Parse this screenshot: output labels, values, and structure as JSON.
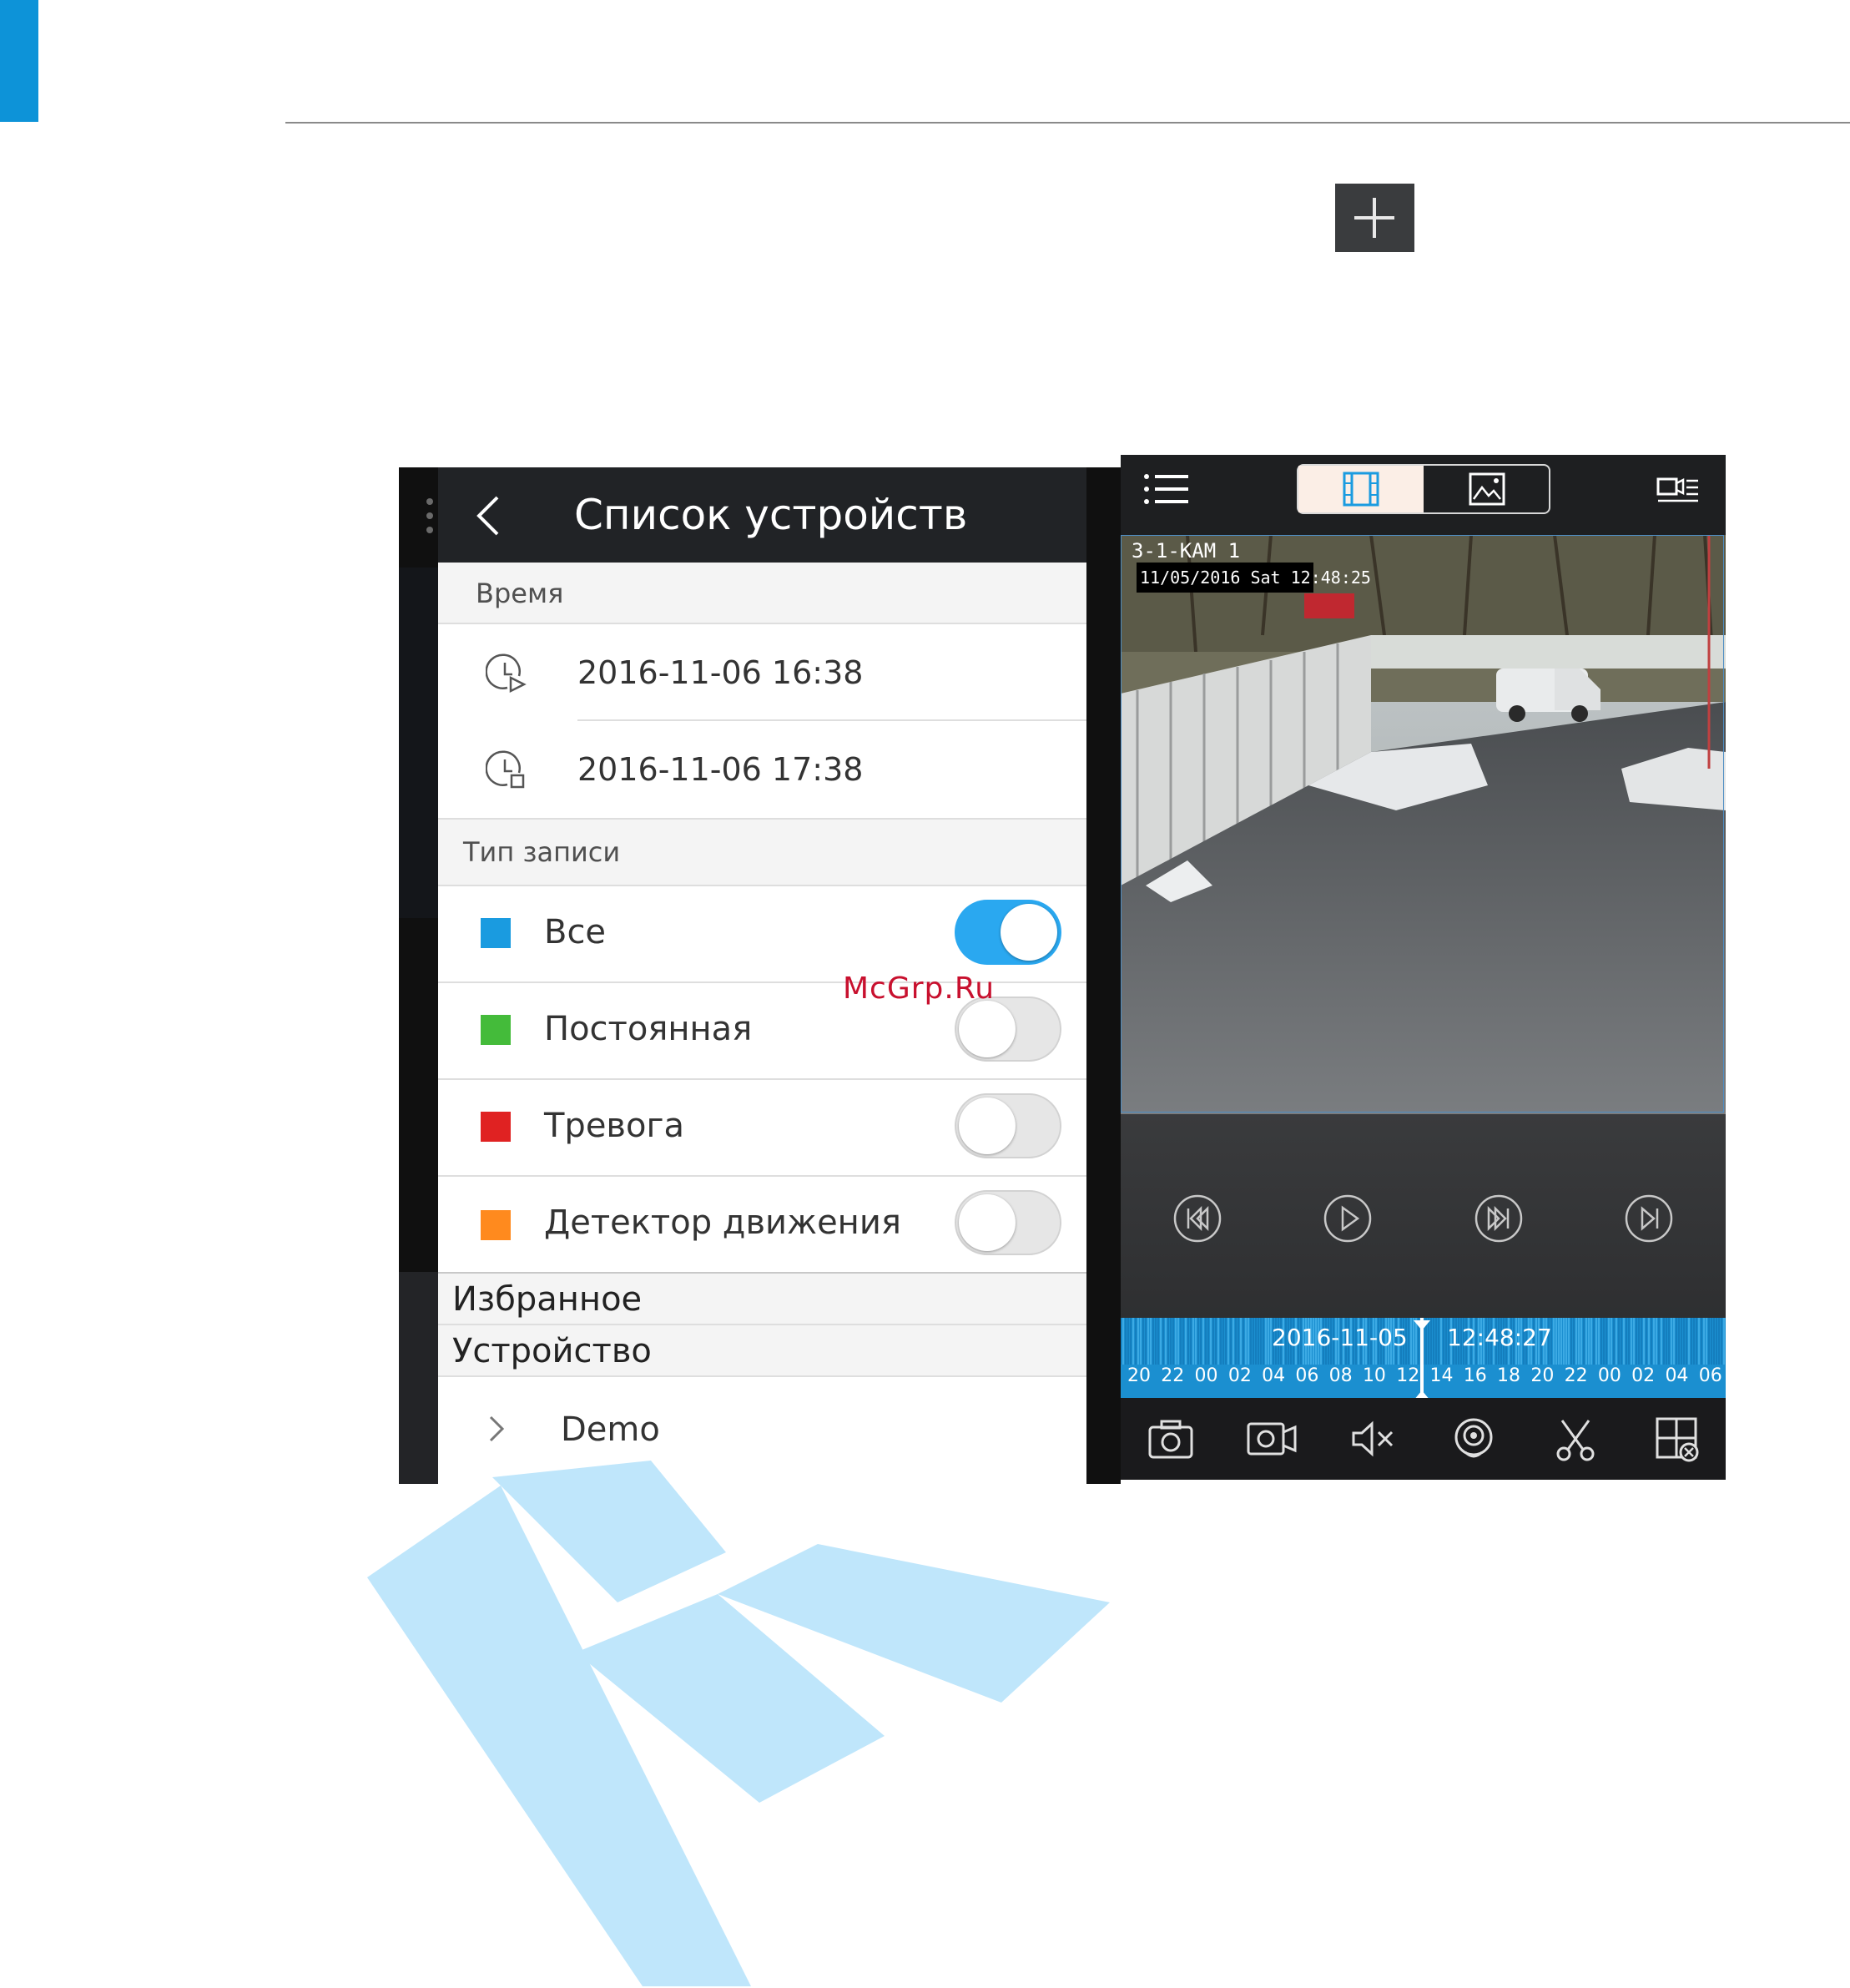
{
  "page": {
    "watermark_text": "McGrp.Ru",
    "accent_color": "#0d93d8"
  },
  "left_screen": {
    "title": "Список устройств",
    "time_section": {
      "label": "Время",
      "start": "2016-11-06 16:38",
      "end": "2016-11-06 17:38"
    },
    "record_type_section": {
      "label": "Тип записи",
      "items": [
        {
          "label": "Все",
          "color": "#1a9be0",
          "enabled": true
        },
        {
          "label": "Постоянная",
          "color": "#44bb3a",
          "enabled": false
        },
        {
          "label": "Тревога",
          "color": "#e02222",
          "enabled": false
        },
        {
          "label": "Детектор движения",
          "color": "#ff8a1e",
          "enabled": false
        }
      ]
    },
    "favorites_label": "Избранное",
    "device_label": "Устройство",
    "devices": [
      {
        "name": "Demo"
      }
    ]
  },
  "right_screen": {
    "tabs": [
      {
        "icon": "video-film-icon",
        "selected": true
      },
      {
        "icon": "image-picture-icon",
        "selected": false
      }
    ],
    "video": {
      "channel_label": "3-1-КАМ 1",
      "osd_timestamp": "11/05/2016 Sat 12:48:25"
    },
    "playback_controls": [
      "rewind-icon",
      "play-icon",
      "fast-forward-icon",
      "step-forward-icon"
    ],
    "timeline": {
      "date": "2016-11-05",
      "time": "12:48:27",
      "hours": [
        "20",
        "22",
        "00",
        "02",
        "04",
        "06",
        "08",
        "10",
        "12",
        "14",
        "16",
        "18",
        "20",
        "22",
        "00",
        "02",
        "04",
        "06"
      ]
    },
    "toolbar": [
      "snapshot-camera-icon",
      "record-video-icon",
      "mute-speaker-icon",
      "capture-icon",
      "scissors-clip-icon",
      "close-window-icon"
    ]
  }
}
